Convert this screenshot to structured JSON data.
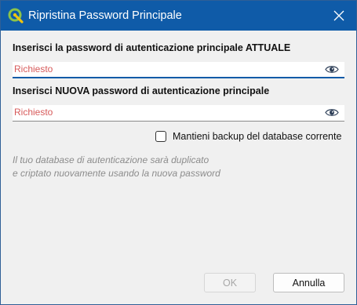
{
  "window": {
    "title": "Ripristina Password Principale",
    "icon": "qgis-logo-icon",
    "close_icon": "close-icon"
  },
  "form": {
    "current_label": "Inserisci la password di autenticazione principale ATTUALE",
    "current_placeholder": "Richiesto",
    "current_value": "",
    "new_label": "Inserisci NUOVA password di autenticazione principale",
    "new_placeholder": "Richiesto",
    "new_value": "",
    "show_password_icon": "eye-icon",
    "backup_label": "Mantieni backup del database corrente",
    "backup_checked": false,
    "info_line1": "Il tuo database di autenticazione sarà duplicato",
    "info_line2": "e criptato nuovamente usando la nuova password"
  },
  "buttons": {
    "ok": "OK",
    "ok_enabled": false,
    "cancel": "Annulla"
  },
  "colors": {
    "titlebar": "#0f5ba8",
    "placeholder": "#d75a5a",
    "info_text": "#8c8c8c"
  }
}
